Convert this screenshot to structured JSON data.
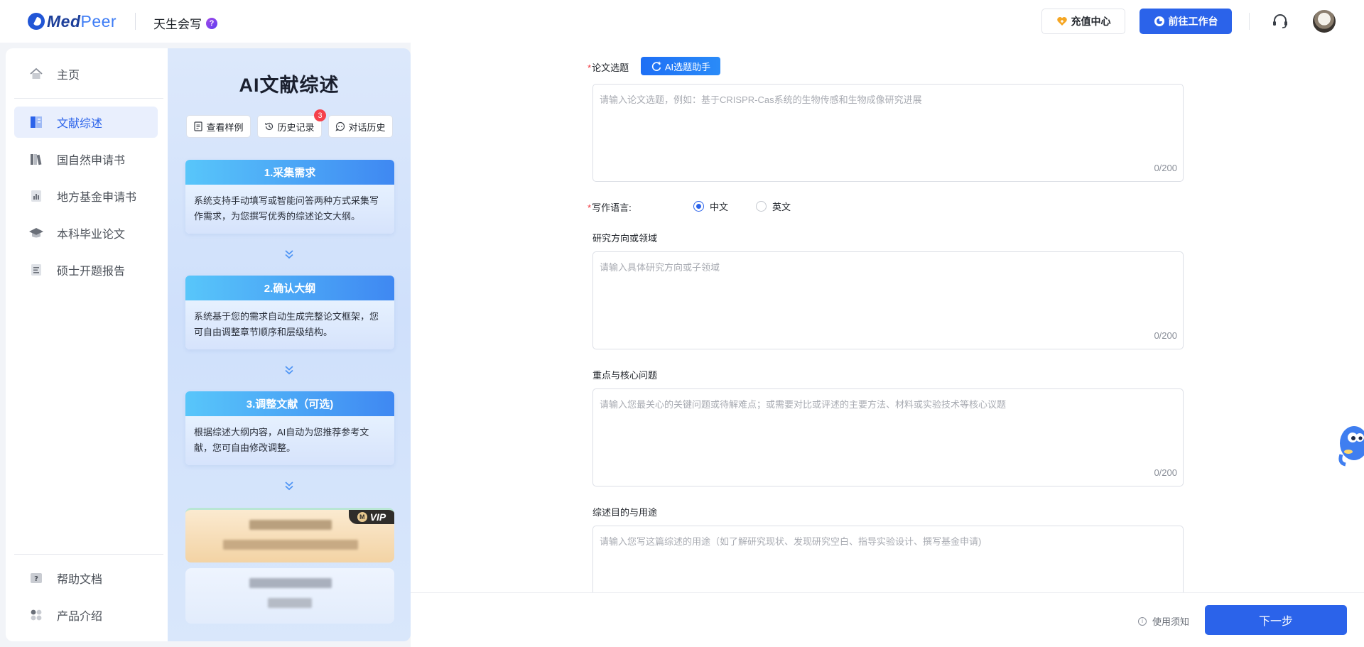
{
  "header": {
    "brand_med": "Med",
    "brand_peer": "Peer",
    "app_name": "天生会写",
    "help_mark": "?",
    "recharge_label": "充值中心",
    "workbench_label": "前往工作台"
  },
  "nav": {
    "items": [
      {
        "label": "主页",
        "icon": "home-icon"
      },
      {
        "label": "文献综述",
        "icon": "literature-icon"
      },
      {
        "label": "国自然申请书",
        "icon": "books-icon"
      },
      {
        "label": "地方基金申请书",
        "icon": "chart-doc-icon"
      },
      {
        "label": "本科毕业论文",
        "icon": "graduation-cap-icon"
      },
      {
        "label": "硕士开题报告",
        "icon": "report-icon"
      }
    ],
    "bottom": [
      {
        "label": "帮助文档",
        "icon": "help-doc-icon"
      },
      {
        "label": "产品介绍",
        "icon": "apps-icon"
      }
    ],
    "active_index": 1
  },
  "guide": {
    "title": "AI文献综述",
    "buttons": [
      {
        "label": "查看样例",
        "icon": "doc-icon"
      },
      {
        "label": "历史记录",
        "icon": "history-icon",
        "badge": "3"
      },
      {
        "label": "对话历史",
        "icon": "chat-icon"
      }
    ],
    "steps": [
      {
        "title": "1.采集需求",
        "desc": "系统支持手动填写或智能问答两种方式采集写作需求，为您撰写优秀的综述论文大纲。"
      },
      {
        "title": "2.确认大纲",
        "desc": "系统基于您的需求自动生成完整论文框架，您可自由调整章节顺序和层级结构。"
      },
      {
        "title": "3.调整文献（可选)",
        "desc": "根据综述大纲内容，AI自动为您推荐参考文献，您可自由修改调整。"
      }
    ],
    "vip_tag": "VIP",
    "vip_m": "M"
  },
  "form": {
    "topic_label": "论文选题",
    "ai_assistant_label": "AI选题助手",
    "topic_placeholder": "请输入论文选题，例如：基于CRISPR-Cas系统的生物传感和生物成像研究进展",
    "topic_count": "0/200",
    "language_label": "写作语言:",
    "language_options": [
      "中文",
      "英文"
    ],
    "language_selected": "中文",
    "direction_label": "研究方向或领域",
    "direction_placeholder": "请输入具体研究方向或子领域",
    "direction_count": "0/200",
    "focus_label": "重点与核心问题",
    "focus_placeholder": "请输入您最关心的关键问题或待解难点；或需要对比或评述的主要方法、材料或实验技术等核心议题",
    "focus_count": "0/200",
    "purpose_label": "综述目的与用途",
    "purpose_placeholder": "请输入您写这篇综述的用途（如了解研究现状、发现研究空白、指导实验设计、撰写基金申请)",
    "required_mark": "*"
  },
  "footer": {
    "notice_label": "使用须知",
    "notice_icon": "i",
    "next_label": "下一步"
  },
  "colors": {
    "primary": "#2b63ea",
    "step_gradient_start": "#58c6fa",
    "step_gradient_end": "#3f88f2",
    "required": "#f0353d"
  }
}
